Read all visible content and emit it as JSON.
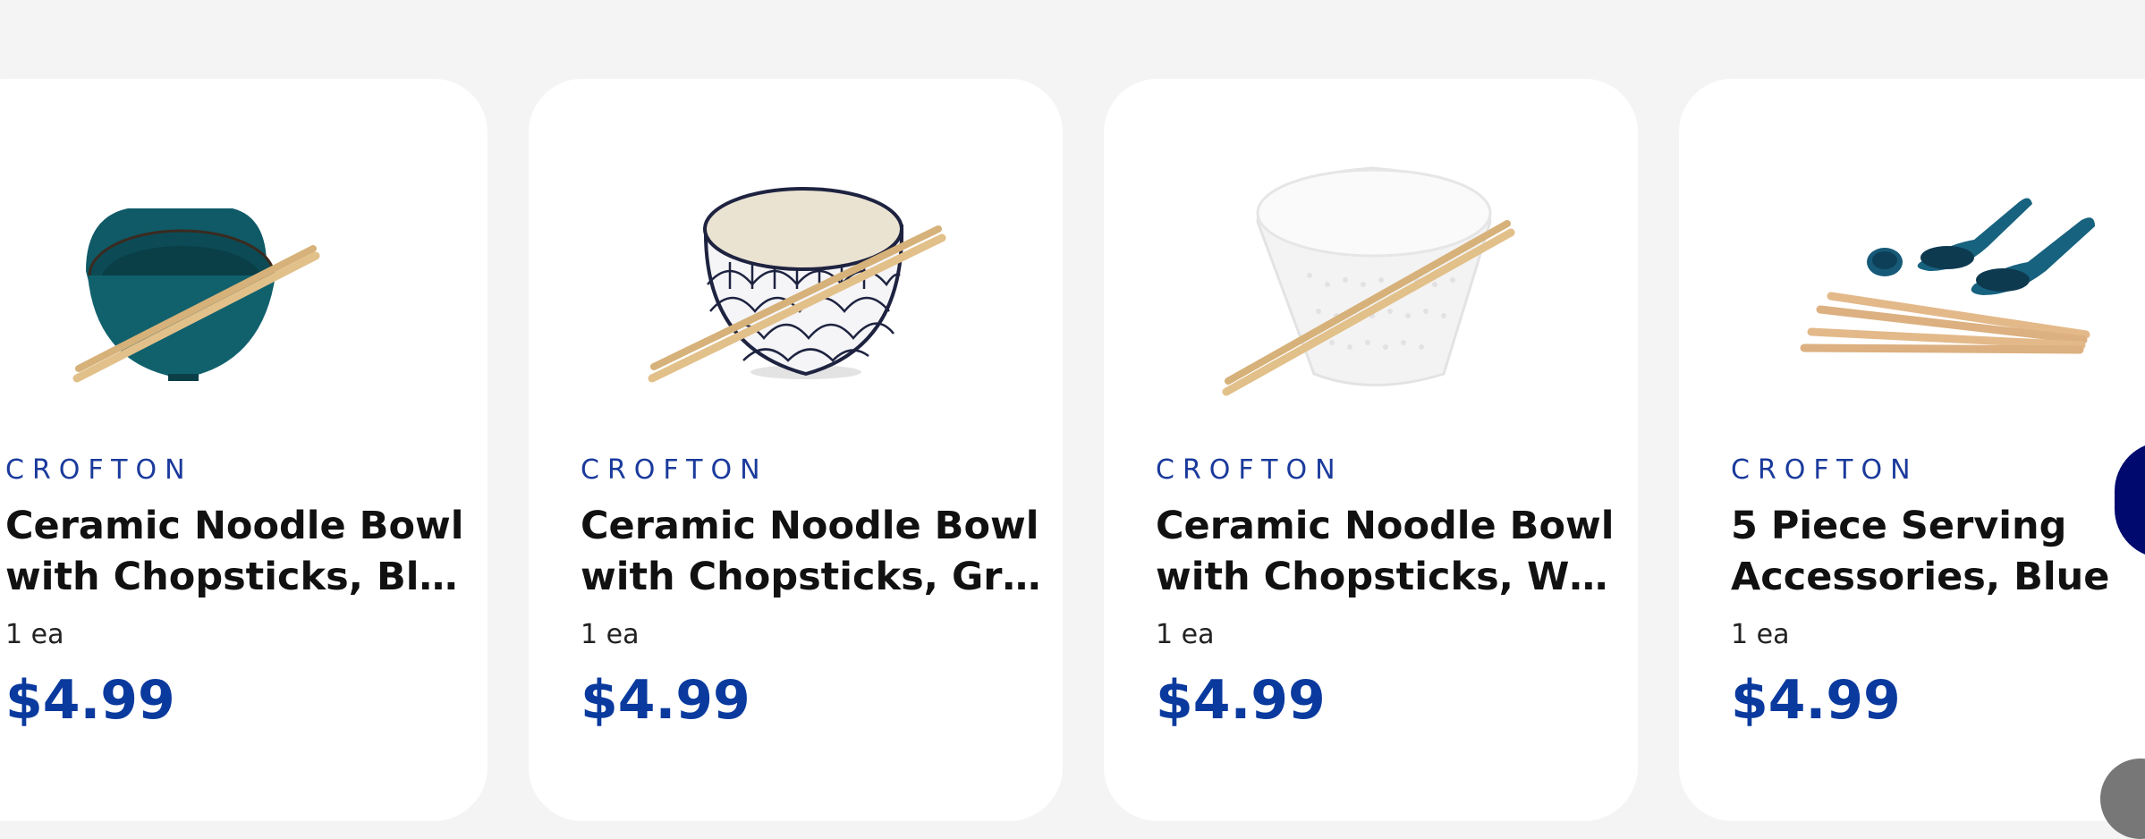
{
  "products": [
    {
      "brand": "CROFTON",
      "title_line1": "Ceramic Noodle Bowl",
      "title_line2": "with Chopsticks, Blue",
      "unit": "1 ea",
      "price": "$4.99",
      "image": "blue-noodle-bowl-with-chopsticks"
    },
    {
      "brand": "CROFTON",
      "title_line1": "Ceramic Noodle Bowl",
      "title_line2": "with Chopsticks, Gra...",
      "unit": "1 ea",
      "price": "$4.99",
      "image": "patterned-noodle-bowl-with-chopsticks"
    },
    {
      "brand": "CROFTON",
      "title_line1": "Ceramic Noodle Bowl",
      "title_line2": "with Chopsticks, White",
      "unit": "1 ea",
      "price": "$4.99",
      "image": "white-noodle-bowl-with-chopsticks"
    },
    {
      "brand": "CROFTON",
      "title_line1": "5 Piece Serving",
      "title_line2": "Accessories, Blue",
      "unit": "1 ea",
      "price": "$4.99",
      "image": "blue-spoons-and-chopsticks"
    }
  ],
  "colors": {
    "brand": "#1a3a9c",
    "price": "#0a3a9e",
    "nav_button": "#000a6e",
    "background": "#f4f4f4"
  },
  "carousel": {
    "next_icon": "chevron-right-icon"
  }
}
